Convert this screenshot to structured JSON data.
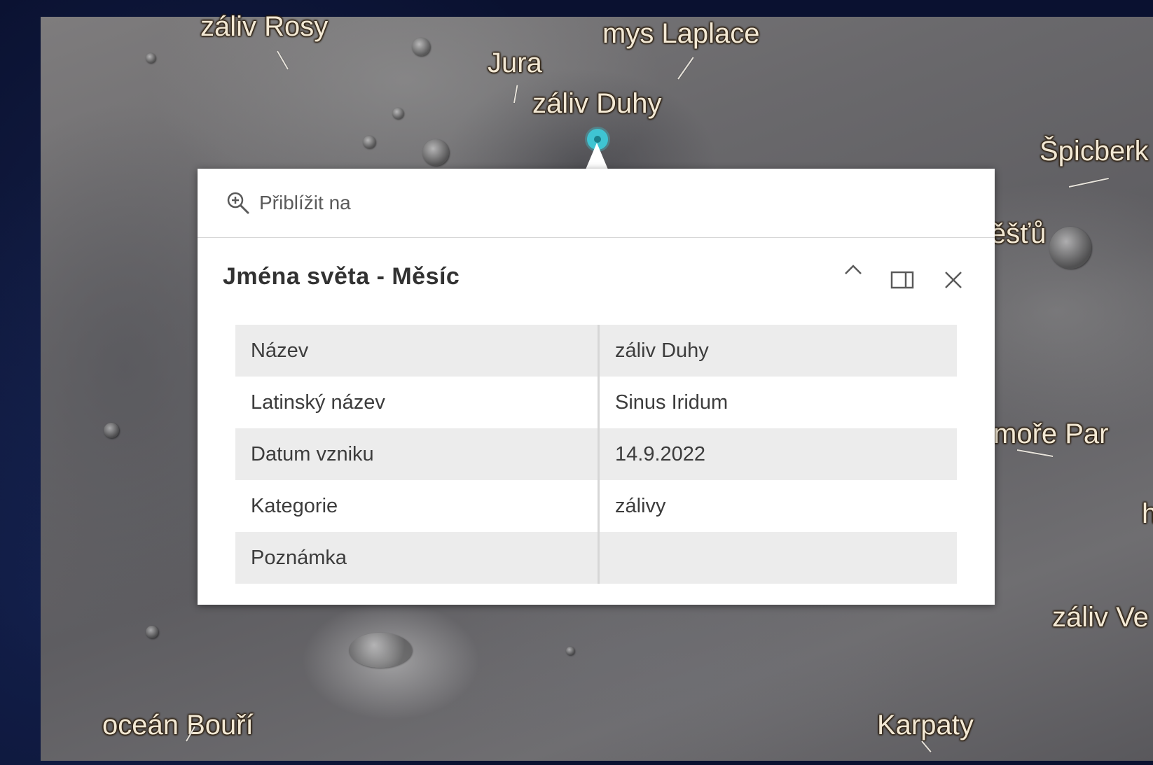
{
  "map": {
    "labels": {
      "zaliv_rosy": "záliv Rosy",
      "mys_laplace": "mys Laplace",
      "jura": "Jura",
      "zaliv_duhy": "záliv Duhy",
      "spicberk": "Špicberk",
      "estu": "ěšťů",
      "more_par": "moře Par",
      "h": "h",
      "zaliv_ve": "záliv Ve",
      "ocean_bouri": "oceán Bouří",
      "karpaty": "Karpaty"
    },
    "marker_color": "#3fc4d2"
  },
  "popup": {
    "zoom_label": "Přiblížit na",
    "title": "Jména světa - Měsíc",
    "icons": {
      "zoom": "zoom-in-icon",
      "collapse": "chevron-up-icon",
      "dock": "dock-side-icon",
      "close": "close-icon"
    },
    "attributes": [
      {
        "key": "Název",
        "value": "záliv Duhy"
      },
      {
        "key": "Latinský název",
        "value": "Sinus Iridum"
      },
      {
        "key": "Datum vzniku",
        "value": "14.9.2022"
      },
      {
        "key": "Kategorie",
        "value": "zálivy"
      },
      {
        "key": "Poznámka",
        "value": ""
      }
    ]
  }
}
